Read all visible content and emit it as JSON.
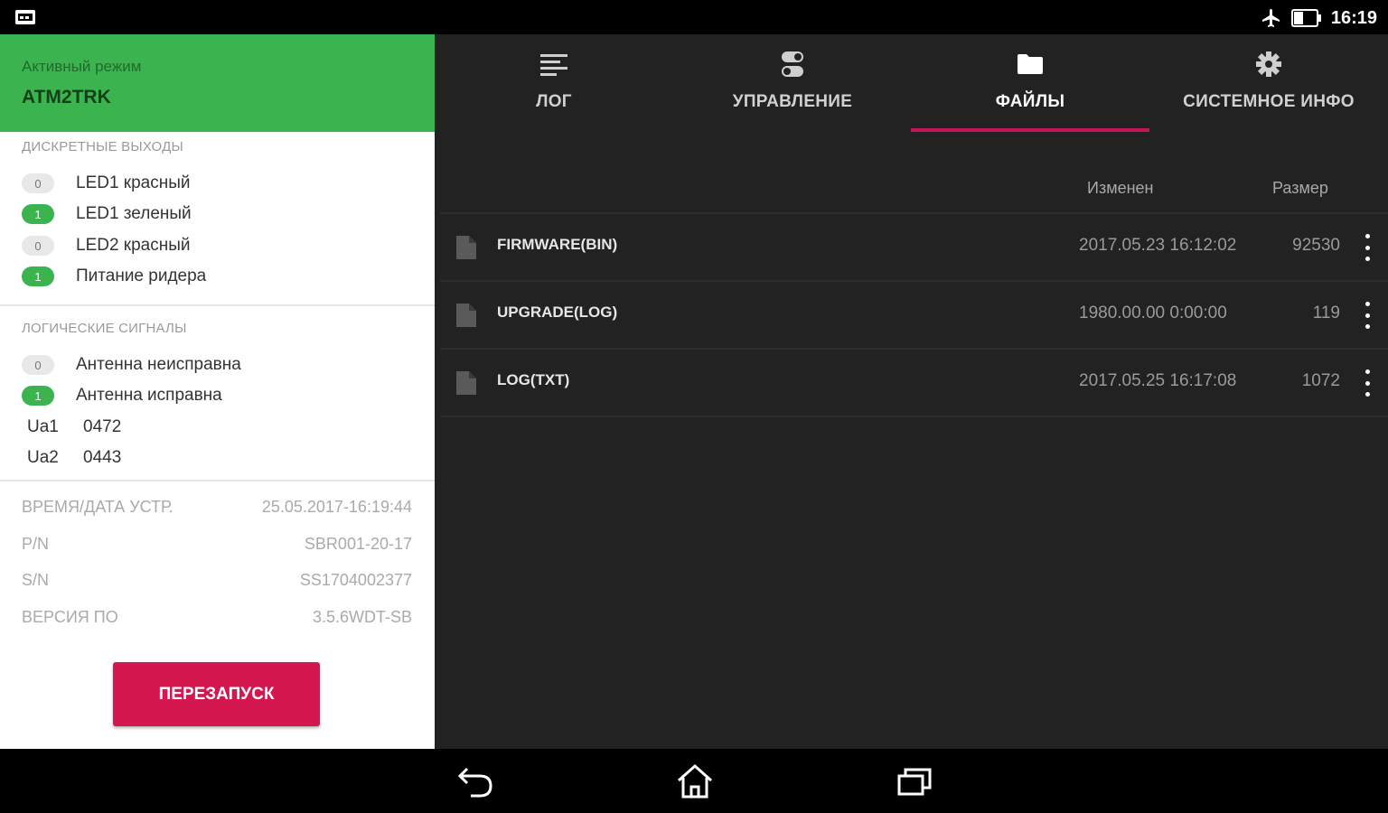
{
  "status_bar": {
    "time": "16:19",
    "icons": [
      "notification-icon",
      "airplane-icon",
      "battery-icon"
    ]
  },
  "left_panel": {
    "mode_label": "Активный режим",
    "mode_value": "ATM2TRK",
    "discrete_outputs": {
      "title": "ДИСКРЕТНЫЕ ВЫХОДЫ",
      "items": [
        {
          "value": "0",
          "label": "LED1 красный",
          "state": "off"
        },
        {
          "value": "1",
          "label": "LED1 зеленый",
          "state": "on"
        },
        {
          "value": "0",
          "label": "LED2 красный",
          "state": "off"
        },
        {
          "value": "1",
          "label": "Питание ридера",
          "state": "on"
        }
      ]
    },
    "logic_signals": {
      "title": "ЛОГИЧЕСКИЕ СИГНАЛЫ",
      "items": [
        {
          "value": "0",
          "label": "Антенна неисправна",
          "state": "off"
        },
        {
          "value": "1",
          "label": "Антенна исправна",
          "state": "on"
        }
      ],
      "ua": [
        {
          "name": "Ua1",
          "value": "0472"
        },
        {
          "name": "Ua2",
          "value": "0443"
        }
      ]
    },
    "device_info": [
      {
        "label": "ВРЕМЯ/ДАТА УСТР.",
        "value": "25.05.2017-16:19:44"
      },
      {
        "label": "P/N",
        "value": "SBR001-20-17"
      },
      {
        "label": "S/N",
        "value": "SS1704002377"
      },
      {
        "label": "ВЕРСИЯ ПО",
        "value": "3.5.6WDT-SB"
      }
    ],
    "restart_label": "ПЕРЕЗАПУСК"
  },
  "tabs": [
    {
      "label": "ЛОГ",
      "icon": "log-icon"
    },
    {
      "label": "УПРАВЛЕНИЕ",
      "icon": "control-icon"
    },
    {
      "label": "ФАЙЛЫ",
      "icon": "folder-icon",
      "active": true
    },
    {
      "label": "СИСТЕМНОЕ ИНФО",
      "icon": "gear-icon"
    }
  ],
  "files": {
    "columns": {
      "modified": "Изменен",
      "size": "Размер"
    },
    "rows": [
      {
        "name": "FIRMWARE(BIN)",
        "date": "2017.05.23  16:12:02",
        "size": "92530"
      },
      {
        "name": "UPGRADE(LOG)",
        "date": "1980.00.00   0:00:00",
        "size": "119"
      },
      {
        "name": "LOG(TXT)",
        "date": "2017.05.25  16:17:08",
        "size": "1072"
      }
    ]
  },
  "colors": {
    "accent_green": "#3bb44f",
    "accent_red": "#d4174f",
    "tab_indicator": "#c2185b",
    "dark_bg": "#222222"
  }
}
